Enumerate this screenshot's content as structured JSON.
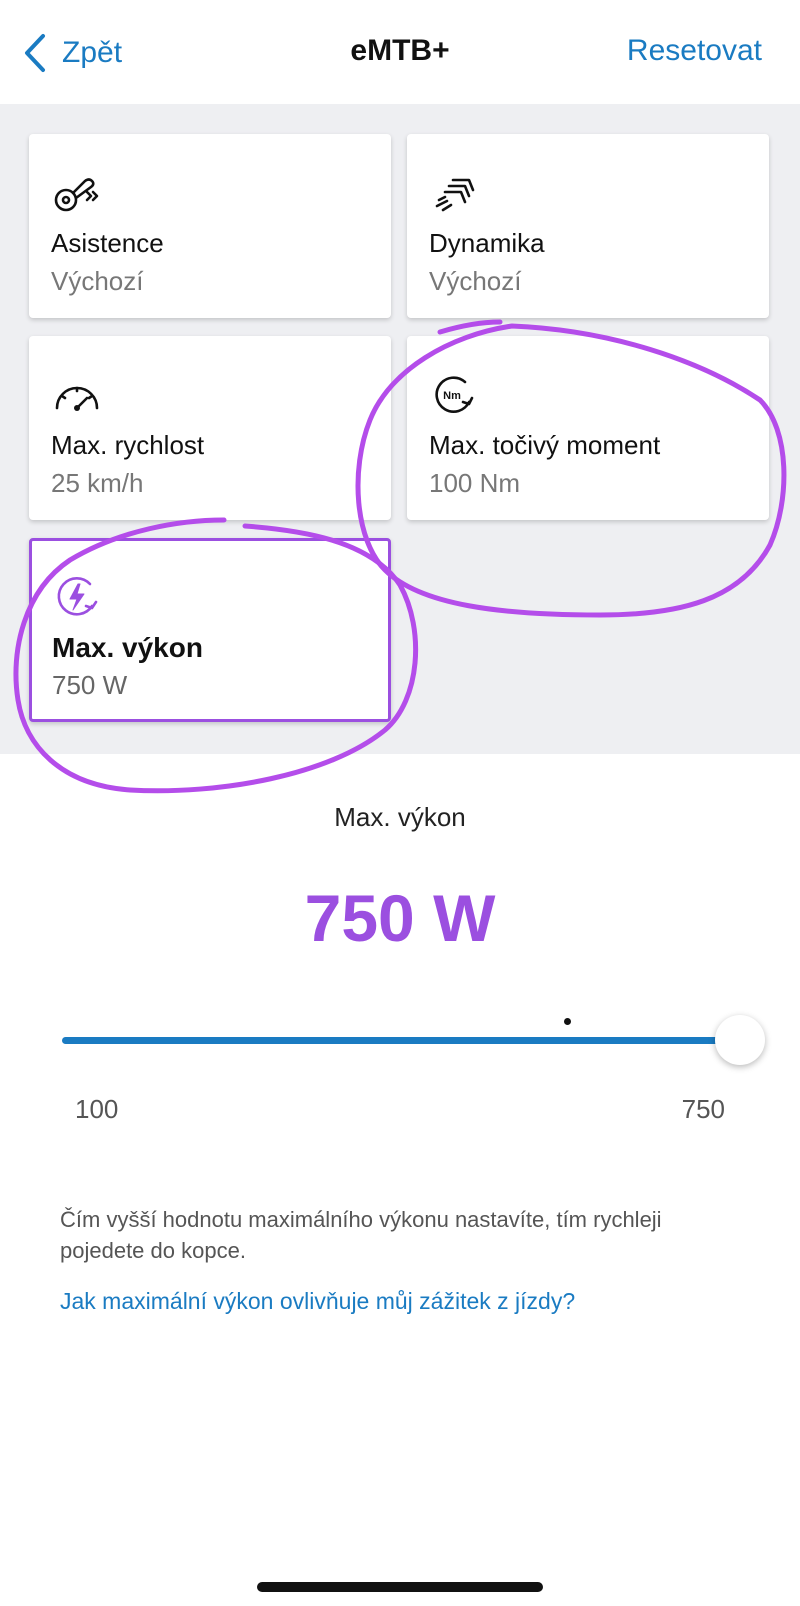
{
  "nav": {
    "back_label": "Zpět",
    "title": "eMTB+",
    "reset_label": "Resetovat"
  },
  "cards": [
    {
      "label": "Asistence",
      "value": "Výchozí",
      "icon": "assist-icon",
      "selected": false
    },
    {
      "label": "Dynamika",
      "value": "Výchozí",
      "icon": "dynamics-icon",
      "selected": false
    },
    {
      "label": "Max. rychlost",
      "value": "25 km/h",
      "icon": "speedometer-icon",
      "selected": false
    },
    {
      "label": "Max. točivý moment",
      "value": "100 Nm",
      "icon": "torque-icon",
      "icon_text": "Nm",
      "selected": false
    },
    {
      "label": "Max. výkon",
      "value": "750 W",
      "icon": "power-icon",
      "selected": true
    }
  ],
  "detail": {
    "title": "Max. výkon",
    "value": "750 W",
    "slider": {
      "min_label": "100",
      "max_label": "750",
      "min": 100,
      "max": 750,
      "value": 750,
      "marker": 600
    },
    "description": "Čím vyšší hodnotu maximálního výkonu nastavíte, tím rychleji pojedete do kopce.",
    "help_link": "Jak maximální výkon ovlivňuje můj zážitek z jízdy?"
  },
  "colors": {
    "accent": "#9b4fe0",
    "link": "#1a7bc2",
    "annotation": "#b44dea"
  }
}
